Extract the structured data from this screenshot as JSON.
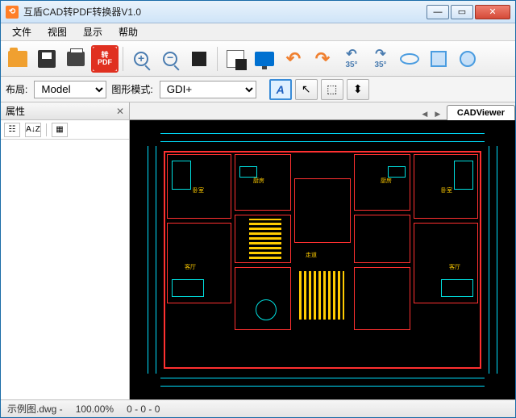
{
  "window": {
    "title": "互盾CAD转PDF转换器V1.0",
    "app_icon_char": "⟲"
  },
  "menu": {
    "file": "文件",
    "view": "视图",
    "display": "显示",
    "help": "帮助"
  },
  "toolbar": {
    "pdf_top": "转",
    "pdf_bottom": "PDF",
    "rotate_angle": "35°"
  },
  "optbar": {
    "layout_label": "布局:",
    "layout_value": "Model",
    "gmode_label": "图形模式:",
    "gmode_value": "GDI+",
    "text_btn": "A",
    "cursor_btn": "↖",
    "select_btn": "⬚",
    "dim_btn": "⬍"
  },
  "sidebar": {
    "props_title": "属性",
    "sort_az": "A↓Z",
    "cat_icon": "☷",
    "list_icon": "▦"
  },
  "viewer": {
    "tab_name": "CADViewer"
  },
  "status": {
    "filename": "示例图.dwg -",
    "zoom": "100.00%",
    "coords": "0 - 0 - 0"
  }
}
